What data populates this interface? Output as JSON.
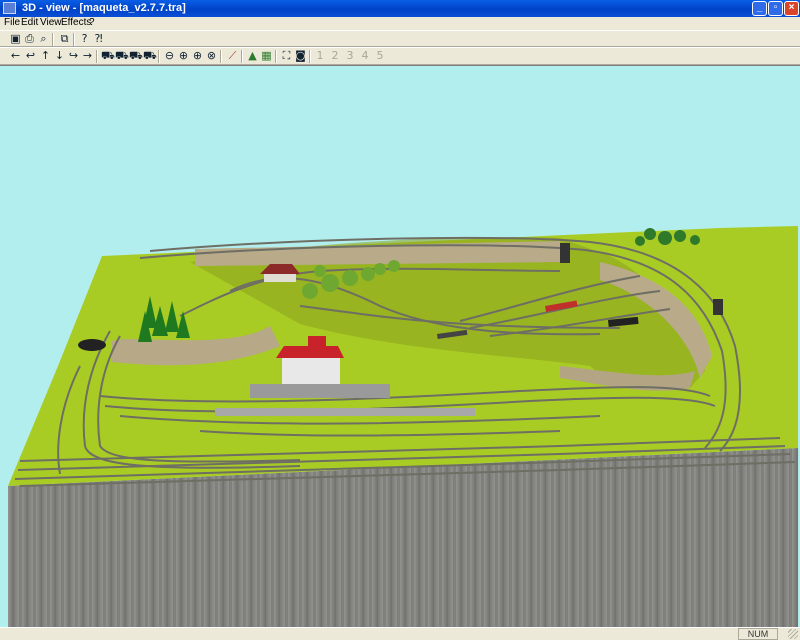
{
  "window": {
    "title": "3D - view - [maqueta_v2.7.7.tra]"
  },
  "menu": {
    "items": [
      "File",
      "Edit",
      "View",
      "Effects",
      "?"
    ]
  },
  "toolbar1": {
    "icons": [
      "save-icon",
      "print-icon",
      "print-preview-icon",
      "copy-icon",
      "help-icon",
      "context-help-icon"
    ]
  },
  "toolbar2": {
    "icons": [
      "arrow-left-icon",
      "arrow-back-icon",
      "arrow-up-icon",
      "arrow-down-icon",
      "arrow-forward-icon",
      "arrow-right-icon",
      "train-icon",
      "train-left-icon",
      "train-down-icon",
      "train-right-icon",
      "zoom-out-icon",
      "zoom-in-icon",
      "zoom-plus-icon",
      "zoom-fit-icon",
      "track-icon",
      "terrain-icon",
      "grid-icon",
      "camera-frame-icon",
      "camera-icon"
    ],
    "camera_presets": [
      "1",
      "2",
      "3",
      "4",
      "5"
    ]
  },
  "status": {
    "num": "NUM"
  },
  "colors": {
    "sky": "#b3eeee",
    "grass": "#a9cc24",
    "cliff": "#8a8a86",
    "track": "#6e6e64"
  }
}
